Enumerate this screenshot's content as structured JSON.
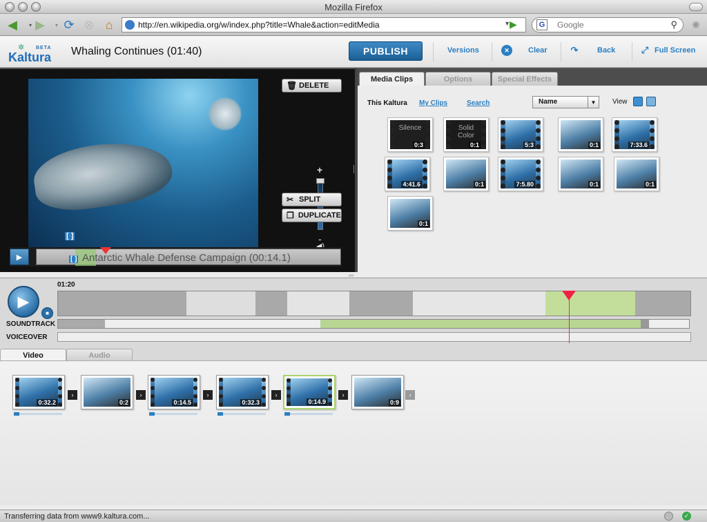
{
  "window": {
    "title": "Mozilla Firefox"
  },
  "nav": {
    "url": "http://en.wikipedia.org/w/index.php?title=Whale&action=editMedia",
    "search_placeholder": "Google"
  },
  "header": {
    "logo_text": "Kaltura",
    "logo_badge": "BETA",
    "title": "Whaling Continues  (01:40)",
    "publish_label": "PUBLISH",
    "versions_label": "Versions",
    "clear_label": "Clear",
    "back_label": "Back",
    "fullscreen_label": "Full Screen"
  },
  "player": {
    "delete_label": "DELETE",
    "split_label": "SPLIT",
    "duplicate_label": "DUPLICATE",
    "volume_plus": "+",
    "volume_minus": "-",
    "scrub_title": "Antarctic Whale Defense Campaign (00:14.1)",
    "bracket": "[ ]"
  },
  "library": {
    "tabs": [
      "Media Clips",
      "Options",
      "Special Effects"
    ],
    "this_label": "This Kaltura",
    "my_clips": "My Clips",
    "search": "Search",
    "sort_value": "Name",
    "view_label": "View",
    "clips": [
      {
        "caption": "Silence",
        "duration": "0:3",
        "type": "silence"
      },
      {
        "caption": "Solid Color",
        "duration": "0:1",
        "type": "color"
      },
      {
        "caption": "",
        "duration": "5:3",
        "type": "video"
      },
      {
        "caption": "",
        "duration": "0:1",
        "type": "image"
      },
      {
        "caption": "",
        "duration": "7:33.6",
        "type": "video"
      },
      {
        "caption": "",
        "duration": "4:41.6",
        "type": "video"
      },
      {
        "caption": "",
        "duration": "0:1",
        "type": "image"
      },
      {
        "caption": "",
        "duration": "7:5.80",
        "type": "video"
      },
      {
        "caption": "",
        "duration": "0:1",
        "type": "image"
      },
      {
        "caption": "",
        "duration": "0:1",
        "type": "image"
      },
      {
        "caption": "",
        "duration": "0:1",
        "type": "image"
      }
    ]
  },
  "timeline": {
    "time": "01:20",
    "soundtrack_label": "SOUNDTRACK",
    "voiceover_label": "VOICEOVER"
  },
  "storyboard": {
    "tabs": [
      "Video",
      "Audio"
    ],
    "clips": [
      {
        "duration": "0:32.2",
        "type": "video"
      },
      {
        "duration": "0:2",
        "type": "image"
      },
      {
        "duration": "0:14.5",
        "type": "video"
      },
      {
        "duration": "0:32.3",
        "type": "video"
      },
      {
        "duration": "0:14.9",
        "type": "video",
        "selected": true
      },
      {
        "duration": "0:9",
        "type": "image"
      }
    ]
  },
  "status": {
    "text": "Transferring data from www9.kaltura.com..."
  },
  "colors": {
    "accent": "#2a7fc2",
    "publish": "#1b5f95",
    "playhead": "#e24444",
    "selection": "#a9d26a"
  }
}
